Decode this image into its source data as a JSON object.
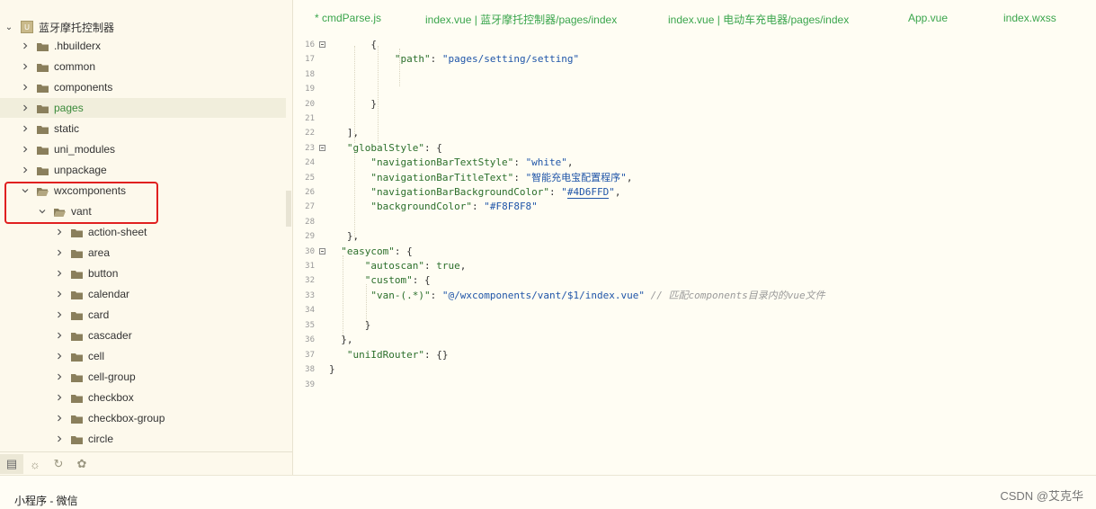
{
  "project": {
    "name": "蓝牙摩托控制器"
  },
  "tree": [
    {
      "label": ".hbuilderx",
      "level": 1,
      "expanded": false
    },
    {
      "label": "common",
      "level": 1,
      "expanded": false
    },
    {
      "label": "components",
      "level": 1,
      "expanded": false
    },
    {
      "label": "pages",
      "level": 1,
      "expanded": false
    },
    {
      "label": "static",
      "level": 1,
      "expanded": false
    },
    {
      "label": "uni_modules",
      "level": 1,
      "expanded": false
    },
    {
      "label": "unpackage",
      "level": 1,
      "expanded": false
    },
    {
      "label": "wxcomponents",
      "level": 1,
      "expanded": true
    },
    {
      "label": "vant",
      "level": 2,
      "expanded": true
    },
    {
      "label": "action-sheet",
      "level": 3,
      "expanded": false
    },
    {
      "label": "area",
      "level": 3,
      "expanded": false
    },
    {
      "label": "button",
      "level": 3,
      "expanded": false
    },
    {
      "label": "calendar",
      "level": 3,
      "expanded": false
    },
    {
      "label": "card",
      "level": 3,
      "expanded": false
    },
    {
      "label": "cascader",
      "level": 3,
      "expanded": false
    },
    {
      "label": "cell",
      "level": 3,
      "expanded": false
    },
    {
      "label": "cell-group",
      "level": 3,
      "expanded": false
    },
    {
      "label": "checkbox",
      "level": 3,
      "expanded": false
    },
    {
      "label": "checkbox-group",
      "level": 3,
      "expanded": false
    },
    {
      "label": "circle",
      "level": 3,
      "expanded": false
    }
  ],
  "tabs": [
    "* cmdParse.js",
    "index.vue | 蓝牙摩托控制器/pages/index",
    "index.vue | 电动车充电器/pages/index",
    "App.vue",
    "index.wxss"
  ],
  "code": {
    "line_numbers": [
      "16",
      "17",
      "18",
      "19",
      "20",
      "21",
      "22",
      "23",
      "24",
      "25",
      "26",
      "27",
      "28",
      "29",
      "30",
      "31",
      "32",
      "33",
      "34",
      "35",
      "36",
      "37",
      "38",
      "39"
    ],
    "path_key": "\"path\"",
    "path_val": "\"pages/setting/setting\"",
    "globalStyle_key": "\"globalStyle\"",
    "navText_key": "\"navigationBarTextStyle\"",
    "navText_val": "\"white\"",
    "navTitle_key": "\"navigationBarTitleText\"",
    "navTitle_val": "\"智能充电宝配置程序\"",
    "navBg_key": "\"navigationBarBackgroundColor\"",
    "navBg_val_q1": "\"",
    "navBg_val_hex": "#4D6FFD",
    "navBg_val_q2": "\"",
    "bg_key": "\"backgroundColor\"",
    "bg_val": "\"#F8F8F8\"",
    "easycom_key": "\"easycom\"",
    "autoscan_key": "\"autoscan\"",
    "autoscan_val": "true",
    "custom_key": "\"custom\"",
    "van_key": "\"van-(.*)\"",
    "van_val": "\"@/wxcomponents/vant/$1/index.vue\"",
    "van_comment": "// 匹配components目录内的vue文件",
    "uniIdRouter_key": "\"uniIdRouter\""
  },
  "status": {
    "left": "小程序 - 微信",
    "right": "CSDN @艾克华"
  }
}
